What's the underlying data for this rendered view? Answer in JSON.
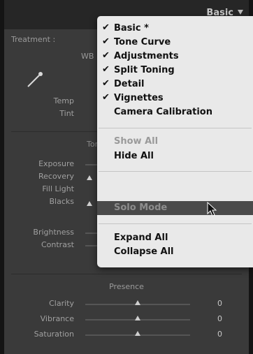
{
  "panel": {
    "title": "Basic",
    "treatment_label": "Treatment :",
    "white_balance_label": "WB :",
    "temp_label": "Temp",
    "tint_label": "Tint",
    "tone_label": "Tone",
    "exposure_label": "Exposure",
    "recovery_label": "Recovery",
    "fill_light_label": "Fill Light",
    "blacks_label": "Blacks",
    "brightness_label": "Brightness",
    "contrast_label": "Contrast",
    "presence_label": "Presence",
    "clarity_label": "Clarity",
    "clarity_value": "0",
    "vibrance_label": "Vibrance",
    "vibrance_value": "0",
    "saturation_label": "Saturation",
    "saturation_value": "0"
  },
  "menu": {
    "items": [
      {
        "label": "Basic *",
        "checked": true
      },
      {
        "label": "Tone Curve",
        "checked": true
      },
      {
        "label": "Adjustments",
        "checked": true
      },
      {
        "label": "Split Toning",
        "checked": true
      },
      {
        "label": "Detail",
        "checked": true
      },
      {
        "label": "Vignettes",
        "checked": true
      },
      {
        "label": "Camera Calibration",
        "checked": false
      },
      {
        "label": "Show All",
        "disabled": true
      },
      {
        "label": "Hide All"
      },
      {
        "label": "Solo Mode",
        "highlighted": true
      },
      {
        "label": "Expand All"
      },
      {
        "label": "Collapse All"
      }
    ],
    "check_glyph": "✔"
  },
  "colors": {
    "panel_bg": "#3a3a3a",
    "menu_bg": "#e9e9e9",
    "menu_highlight": "#4a4a4a"
  }
}
